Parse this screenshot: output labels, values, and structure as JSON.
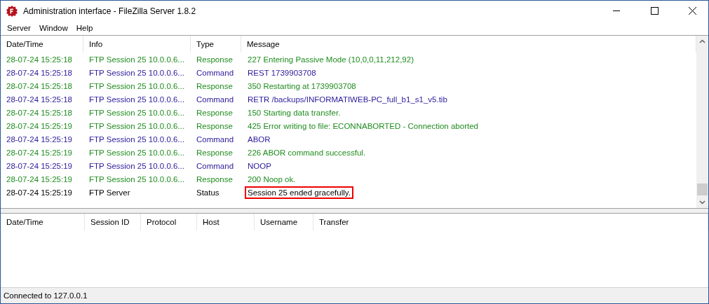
{
  "window": {
    "title": "Administration interface - FileZilla Server 1.8.2"
  },
  "menu": [
    "Server",
    "Window",
    "Help"
  ],
  "log": {
    "columns": [
      "Date/Time",
      "Info",
      "Type",
      "Message"
    ],
    "rows": [
      {
        "kind": "response",
        "cells": [
          "28-07-24 15:25:18",
          "FTP Session 25 10.0.0.6...",
          "Response",
          "227 Entering Passive Mode (10,0,0,11,212,92)"
        ],
        "highlighted": false
      },
      {
        "kind": "command",
        "cells": [
          "28-07-24 15:25:18",
          "FTP Session 25 10.0.0.6...",
          "Command",
          "REST 1739903708"
        ],
        "highlighted": false
      },
      {
        "kind": "response",
        "cells": [
          "28-07-24 15:25:18",
          "FTP Session 25 10.0.0.6...",
          "Response",
          "350 Restarting at 1739903708"
        ],
        "highlighted": false
      },
      {
        "kind": "command",
        "cells": [
          "28-07-24 15:25:18",
          "FTP Session 25 10.0.0.6...",
          "Command",
          "RETR /backups/INFORMATIWEB-PC_full_b1_s1_v5.tib"
        ],
        "highlighted": false
      },
      {
        "kind": "response",
        "cells": [
          "28-07-24 15:25:18",
          "FTP Session 25 10.0.0.6...",
          "Response",
          "150 Starting data transfer."
        ],
        "highlighted": false
      },
      {
        "kind": "response",
        "cells": [
          "28-07-24 15:25:19",
          "FTP Session 25 10.0.0.6...",
          "Response",
          "425 Error writing to file: ECONNABORTED - Connection aborted"
        ],
        "highlighted": false
      },
      {
        "kind": "command",
        "cells": [
          "28-07-24 15:25:19",
          "FTP Session 25 10.0.0.6...",
          "Command",
          "ABOR"
        ],
        "highlighted": false
      },
      {
        "kind": "response",
        "cells": [
          "28-07-24 15:25:19",
          "FTP Session 25 10.0.0.6...",
          "Response",
          "226 ABOR command successful."
        ],
        "highlighted": false
      },
      {
        "kind": "command",
        "cells": [
          "28-07-24 15:25:19",
          "FTP Session 25 10.0.0.6...",
          "Command",
          "NOOP"
        ],
        "highlighted": false
      },
      {
        "kind": "response",
        "cells": [
          "28-07-24 15:25:19",
          "FTP Session 25 10.0.0.6...",
          "Response",
          "200 Noop ok."
        ],
        "highlighted": false
      },
      {
        "kind": "status",
        "cells": [
          "28-07-24 15:25:19",
          "FTP Server",
          "Status",
          "Session 25 ended gracefully."
        ],
        "highlighted": true
      }
    ]
  },
  "sessions": {
    "columns": [
      "Date/Time",
      "Session ID",
      "Protocol",
      "Host",
      "Username",
      "Transfer"
    ]
  },
  "status_bar": "Connected to 127.0.0.1"
}
